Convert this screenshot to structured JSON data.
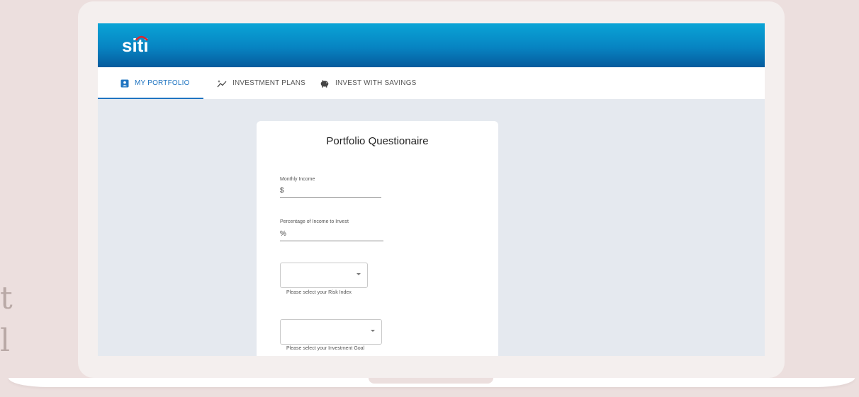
{
  "background": {
    "glyphs": [
      "t",
      "l"
    ]
  },
  "app": {
    "logo": "siti",
    "brand_colors": {
      "header_top": "#0aa4d6",
      "header_bottom": "#065b9d",
      "logo_arc": "#e0242b",
      "accent": "#1f74c1"
    }
  },
  "tabs": [
    {
      "label": "MY PORTFOLIO",
      "icon": "portfolio-badge-icon",
      "active": true
    },
    {
      "label": "INVESTMENT PLANS",
      "icon": "sparkle-chart-icon",
      "active": false
    },
    {
      "label": "INVEST WITH SAVINGS",
      "icon": "piggy-bank-icon",
      "active": false
    }
  ],
  "form": {
    "title": "Portfolio Questionaire",
    "monthly_income": {
      "label": "Monthly Income",
      "prefix": "$",
      "value": ""
    },
    "percentage": {
      "label": "Percentage of Income to Invest",
      "prefix": "%",
      "value": ""
    },
    "risk_index": {
      "selected": "",
      "helper": "Please select your Risk Index"
    },
    "investment_goal": {
      "selected": "",
      "helper": "Please select your Investment Goal"
    }
  }
}
